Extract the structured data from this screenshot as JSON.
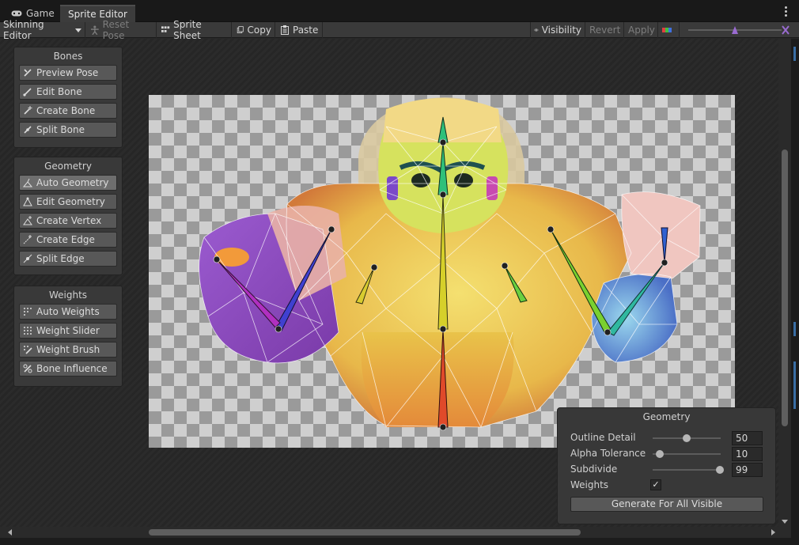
{
  "tabs": [
    {
      "label": "Game"
    },
    {
      "label": "Sprite Editor"
    }
  ],
  "toolbar": {
    "mode": "Skinning Editor",
    "reset_pose": "Reset Pose",
    "sprite_sheet": "Sprite Sheet",
    "copy": "Copy",
    "paste": "Paste",
    "visibility": "Visibility",
    "revert": "Revert",
    "apply": "Apply"
  },
  "panels": {
    "bones": {
      "title": "Bones",
      "items": [
        {
          "label": "Preview Pose"
        },
        {
          "label": "Edit Bone"
        },
        {
          "label": "Create Bone"
        },
        {
          "label": "Split Bone"
        }
      ]
    },
    "geometry": {
      "title": "Geometry",
      "items": [
        {
          "label": "Auto Geometry"
        },
        {
          "label": "Edit Geometry"
        },
        {
          "label": "Create Vertex"
        },
        {
          "label": "Create Edge"
        },
        {
          "label": "Split Edge"
        }
      ]
    },
    "weights": {
      "title": "Weights",
      "items": [
        {
          "label": "Auto Weights"
        },
        {
          "label": "Weight Slider"
        },
        {
          "label": "Weight Brush"
        },
        {
          "label": "Bone Influence"
        }
      ]
    }
  },
  "geometry_popup": {
    "title": "Geometry",
    "outline_detail": {
      "label": "Outline Detail",
      "value": "50",
      "fraction": 0.5
    },
    "alpha_tolerance": {
      "label": "Alpha Tolerance",
      "value": "10",
      "fraction": 0.1
    },
    "subdivide": {
      "label": "Subdivide",
      "value": "99",
      "fraction": 0.99
    },
    "weights": {
      "label": "Weights",
      "checked": true,
      "check_glyph": "✓"
    },
    "generate_button": "Generate For All Visible"
  }
}
